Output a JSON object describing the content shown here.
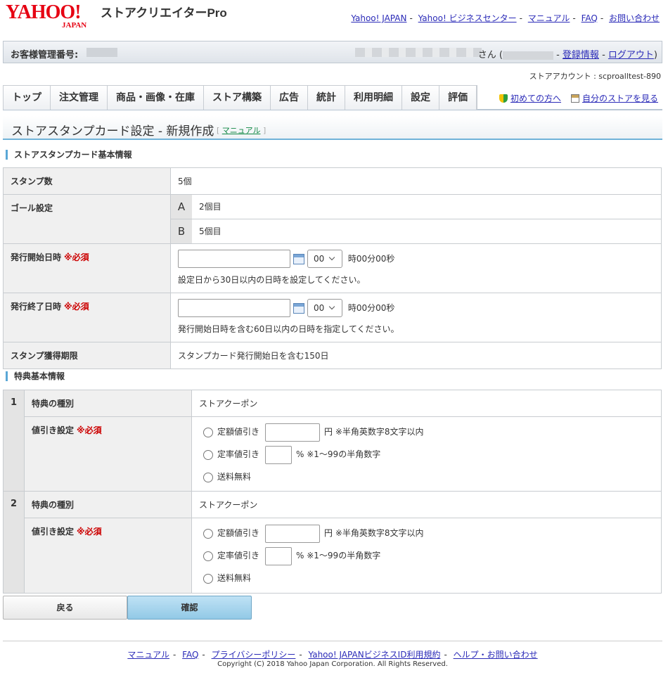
{
  "header": {
    "logo_main": "YAHOO!",
    "logo_sub": "JAPAN",
    "product_name": "ストアクリエイターPro",
    "links": [
      "Yahoo! JAPAN",
      "Yahoo! ビジネスセンター",
      "マニュアル",
      "FAQ",
      "お問い合わせ"
    ]
  },
  "customer_bar": {
    "label": "お客様管理番号:",
    "san": "さん (",
    "register_link": "登録情報",
    "logout_link": "ログアウト",
    "close_paren": ")"
  },
  "store_account": "ストアアカウント : scproalltest-890",
  "nav": {
    "tabs": [
      "トップ",
      "注文管理",
      "商品・画像・在庫",
      "ストア構築",
      "広告",
      "統計",
      "利用明細",
      "設定",
      "評価"
    ],
    "beginner_link": "初めての方へ",
    "view_store_link": "自分のストアを見る"
  },
  "page": {
    "title": "ストアスタンプカード設定 - 新規作成",
    "manual_link": "マニュアル"
  },
  "basic_section": {
    "heading": "ストアスタンプカード基本情報",
    "stamp_count_label": "スタンプ数",
    "stamp_count_value": "5個",
    "goal_label": "ゴール設定",
    "goals": [
      {
        "key": "A",
        "value": "2個目"
      },
      {
        "key": "B",
        "value": "5個目"
      }
    ],
    "start_label": "発行開始日時",
    "end_label": "発行終了日時",
    "required": "※必須",
    "hour_value": "00",
    "time_suffix": "時00分00秒",
    "start_note": "設定日から30日以内の日時を設定してください。",
    "end_note": "発行開始日時を含む60日以内の日時を指定してください。",
    "period_label": "スタンプ獲得期限",
    "period_value": "スタンプカード発行開始日を含む150日"
  },
  "benefit_section": {
    "heading": "特典基本情報",
    "items": [
      {
        "num": "1",
        "type_label": "特典の種別",
        "type_value": "ストアクーポン",
        "discount_label": "値引き設定",
        "required": "※必須",
        "opt_fixed": "定額値引き",
        "fixed_note": "円 ※半角英数字8文字以内",
        "opt_rate": "定率値引き",
        "rate_note": "% ※1～99の半角数字",
        "opt_free": "送料無料"
      },
      {
        "num": "2",
        "type_label": "特典の種別",
        "type_value": "ストアクーポン",
        "discount_label": "値引き設定",
        "required": "※必須",
        "opt_fixed": "定額値引き",
        "fixed_note": "円 ※半角英数字8文字以内",
        "opt_rate": "定率値引き",
        "rate_note": "% ※1～99の半角数字",
        "opt_free": "送料無料"
      }
    ]
  },
  "buttons": {
    "back": "戻る",
    "confirm": "確認"
  },
  "footer": {
    "links": [
      "マニュアル",
      "FAQ",
      "プライバシーポリシー",
      "Yahoo! JAPANビジネスID利用規約",
      "ヘルプ・お問い合わせ"
    ],
    "copyright": "Copyright (C) 2018 Yahoo Japan Corporation. All Rights Reserved."
  }
}
